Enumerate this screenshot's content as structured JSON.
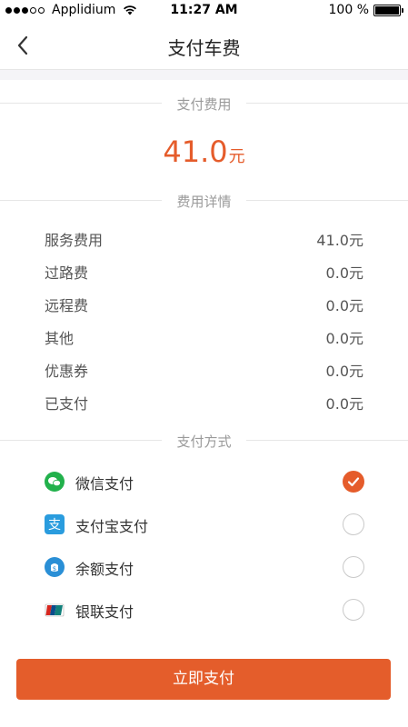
{
  "status_bar": {
    "carrier": "Applidium",
    "time": "11:27 AM",
    "battery": "100 %",
    "battery_level": 1.0
  },
  "nav": {
    "title": "支付车费",
    "back_icon": "chevron-left-icon"
  },
  "payment_amount": {
    "section_label": "支付费用",
    "amount": "41.0",
    "unit": "元"
  },
  "fee_details": {
    "section_label": "费用详情",
    "rows": [
      {
        "name": "服务费用",
        "value": "41.0元"
      },
      {
        "name": "过路费",
        "value": "0.0元"
      },
      {
        "name": "远程费",
        "value": "0.0元"
      },
      {
        "name": "其他",
        "value": "0.0元"
      },
      {
        "name": "优惠券",
        "value": "0.0元"
      },
      {
        "name": "已支付",
        "value": "0.0元"
      }
    ]
  },
  "payment_methods": {
    "section_label": "支付方式",
    "options": [
      {
        "label": "微信支付",
        "icon": "wechat-icon",
        "selected": true
      },
      {
        "label": "支付宝支付",
        "icon": "alipay-icon",
        "selected": false
      },
      {
        "label": "余额支付",
        "icon": "balance-icon",
        "selected": false
      },
      {
        "label": "银联支付",
        "icon": "unionpay-icon",
        "selected": false
      }
    ]
  },
  "submit_button": {
    "label": "立即支付"
  },
  "colors": {
    "accent": "#e55c2b",
    "muted_text": "#9a9a9a",
    "divider": "#e6e6e6"
  }
}
